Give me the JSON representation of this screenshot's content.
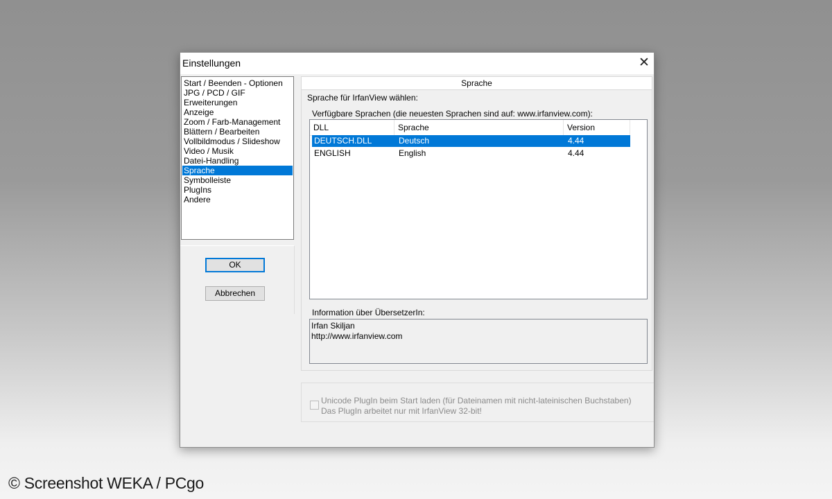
{
  "window": {
    "title": "Einstellungen",
    "close_glyph": "✕"
  },
  "nav": {
    "items": [
      {
        "label": "Start / Beenden - Optionen",
        "selected": false
      },
      {
        "label": "JPG / PCD / GIF",
        "selected": false
      },
      {
        "label": "Erweiterungen",
        "selected": false
      },
      {
        "label": "Anzeige",
        "selected": false
      },
      {
        "label": "Zoom / Farb-Management",
        "selected": false
      },
      {
        "label": "Blättern / Bearbeiten",
        "selected": false
      },
      {
        "label": "Vollbildmodus / Slideshow",
        "selected": false
      },
      {
        "label": "Video / Musik",
        "selected": false
      },
      {
        "label": "Datei-Handling",
        "selected": false
      },
      {
        "label": "Sprache",
        "selected": true
      },
      {
        "label": "Symbolleiste",
        "selected": false
      },
      {
        "label": "PlugIns",
        "selected": false
      },
      {
        "label": "Andere",
        "selected": false
      }
    ]
  },
  "buttons": {
    "ok": "OK",
    "cancel": "Abbrechen"
  },
  "panel": {
    "tab_title": "Sprache",
    "group_label": "Sprache für IrfanView wählen:",
    "list_label": "Verfügbare Sprachen (die neuesten Sprachen sind auf: www.irfanview.com):",
    "columns": [
      "DLL",
      "Sprache",
      "Version"
    ],
    "rows": [
      {
        "dll": "DEUTSCH.DLL",
        "language": "Deutsch",
        "version": "4.44",
        "selected": true
      },
      {
        "dll": "ENGLISH",
        "language": "English",
        "version": "4.44",
        "selected": false
      }
    ],
    "info_label": "Information über ÜbersetzerIn:",
    "info_lines": [
      "Irfan Skiljan",
      "http://www.irfanview.com"
    ]
  },
  "unicode_option": {
    "checked": false,
    "line1": "Unicode PlugIn beim Start laden (für Dateinamen mit nicht-lateinischen Buchstaben)",
    "line2": "Das PlugIn arbeitet nur mit IrfanView 32-bit!"
  },
  "watermark": "© Screenshot WEKA / PCgo",
  "colors": {
    "selection": "#0078d7",
    "default_button_border": "#0078d7"
  }
}
